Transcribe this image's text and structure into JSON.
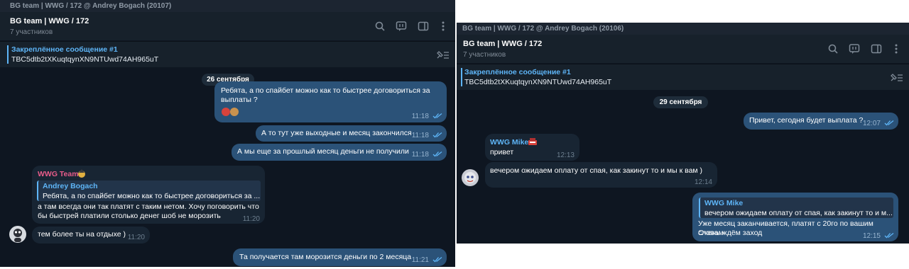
{
  "left": {
    "titlebar": "BG team | WWG / 172 @ Andrey Bogach (20107)",
    "chat_title": "BG team | WWG / 172",
    "chat_subtitle": "7 участников",
    "pinned_title": "Закреплённое сообщение #1",
    "pinned_text": "TBC5dtb2tXKuqtqynXN9NTUwd74AH965uT",
    "date": "26 сентября",
    "messages": [
      {
        "line1": "Ребята, а по спайбет можно как то быстрее договориться за",
        "line2": "выплаты ?",
        "time": "11:18"
      },
      {
        "text": "А то тут уже выходные и месяц закончился",
        "time": "11:18"
      },
      {
        "text": "А мы еще за прошлый месяц деньги не получили",
        "time": "11:18"
      },
      {
        "sender": "WWG Team",
        "quote_name": "Andrey Bogach",
        "quote_text": "Ребята, а по спайбет можно как то быстрее договориться за ...",
        "line1": "а там всегда они так платят с таким нетом. Хочу поговорить что",
        "line2": "бы быстрей платили столько денег шоб не морозить",
        "time": "11:20"
      },
      {
        "text": "тем более ты на отдыхе )",
        "time": "11:20"
      },
      {
        "text": "Та получается там морозится деньги по 2 месяца",
        "time": "11:21"
      }
    ]
  },
  "right": {
    "titlebar": "BG team | WWG / 172 @ Andrey Bogach (20106)",
    "chat_title": "BG team | WWG / 172",
    "chat_subtitle": "7 участников",
    "pinned_title": "Закреплённое сообщение #1",
    "pinned_text": "TBC5dtb2tXKuqtqynXN9NTUwd74AH965uT",
    "date": "29 сентября",
    "messages": [
      {
        "text": "Привет, сегодня будет выплата ?",
        "time": "12:07"
      },
      {
        "sender": "WWG Mike",
        "text": "привет",
        "time": "12:13"
      },
      {
        "text": "вечером ожидаем оплату от спая, как закинут то и мы к вам )",
        "time": "12:14"
      },
      {
        "quote_name": "WWG Mike",
        "quote_text": "вечером ожидаем оплату от спая, как закинут то и м...",
        "line1": "Уже месяц заканчивается, платят с 20го по вашим словам",
        "line2": "Очень ждём заход",
        "time": "12:15"
      }
    ]
  },
  "colors": {
    "accent": "#5eb5f7",
    "outgoing": "#2b5278",
    "incoming": "#182533",
    "background": "#0e1621",
    "wwg_team_name": "#e85c8a"
  },
  "icons": [
    "search-icon",
    "comments-icon",
    "sidebar-icon",
    "more-icon",
    "pin-list-icon",
    "double-check-icon"
  ]
}
